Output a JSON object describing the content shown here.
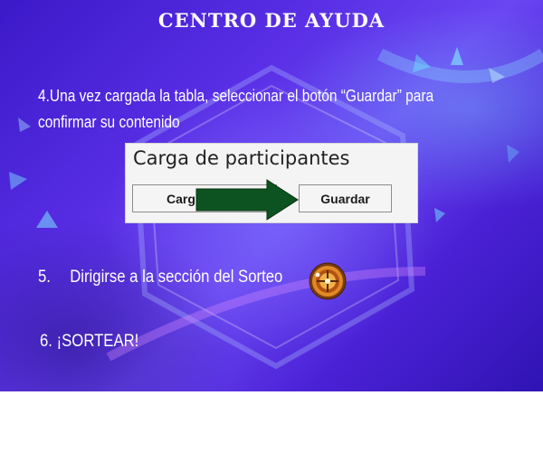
{
  "header": {
    "title": "CENTRO DE AYUDA"
  },
  "steps": {
    "step4": {
      "text": "4.Una vez cargada la tabla, seleccionar el botón “Guardar” para confirmar su contenido"
    },
    "step5": {
      "number": "5.",
      "text": "Dirigirse a la sección del Sorteo",
      "icon": "roulette-icon"
    },
    "step6": {
      "text": "6. ¡SORTEAR!"
    }
  },
  "screenshot": {
    "title": "Carga de participantes",
    "load_button_label": "Carg",
    "save_button_label": "Guardar",
    "arrow_color": "#0d5321"
  },
  "colors": {
    "background_primary": "#4b21d6",
    "text": "#ffffff"
  }
}
